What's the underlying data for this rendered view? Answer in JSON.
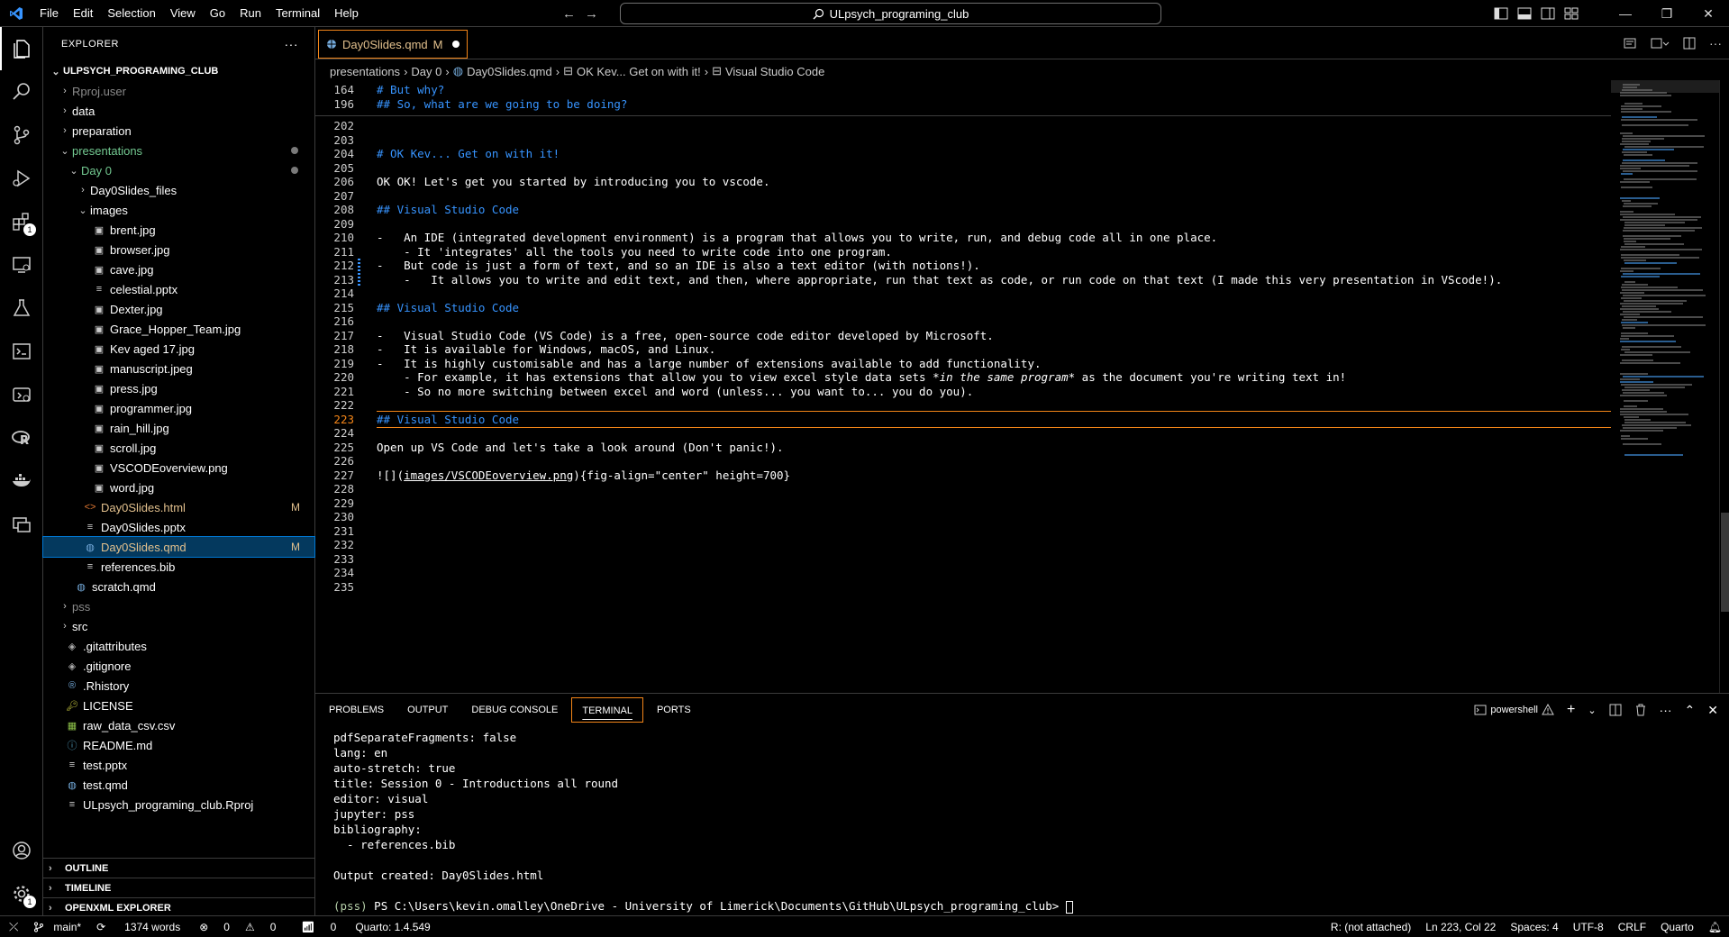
{
  "menu": [
    "File",
    "Edit",
    "Selection",
    "View",
    "Go",
    "Run",
    "Terminal",
    "Help"
  ],
  "search_label": "ULpsych_programing_club",
  "explorer": {
    "title": "EXPLORER",
    "more": "···",
    "root": "ULPSYCH_PROGRAMING_CLUB",
    "items": [
      {
        "label": "Rproj.user",
        "depth": 1,
        "type": "folder",
        "open": false,
        "muted": true
      },
      {
        "label": "data",
        "depth": 1,
        "type": "folder",
        "open": false
      },
      {
        "label": "preparation",
        "depth": 1,
        "type": "folder",
        "open": false
      },
      {
        "label": "presentations",
        "depth": 1,
        "type": "folder",
        "open": true,
        "color": "#73c991",
        "dot": true
      },
      {
        "label": "Day 0",
        "depth": 2,
        "type": "folder",
        "open": true,
        "color": "#73c991",
        "dot": true
      },
      {
        "label": "Day0Slides_files",
        "depth": 3,
        "type": "folder",
        "open": false
      },
      {
        "label": "images",
        "depth": 3,
        "type": "folder",
        "open": true
      },
      {
        "label": "brent.jpg",
        "depth": 4,
        "type": "img"
      },
      {
        "label": "browser.jpg",
        "depth": 4,
        "type": "img"
      },
      {
        "label": "cave.jpg",
        "depth": 4,
        "type": "img"
      },
      {
        "label": "celestial.pptx",
        "depth": 4,
        "type": "doc"
      },
      {
        "label": "Dexter.jpg",
        "depth": 4,
        "type": "img"
      },
      {
        "label": "Grace_Hopper_Team.jpg",
        "depth": 4,
        "type": "img"
      },
      {
        "label": "Kev aged 17.jpg",
        "depth": 4,
        "type": "img"
      },
      {
        "label": "manuscript.jpeg",
        "depth": 4,
        "type": "img"
      },
      {
        "label": "press.jpg",
        "depth": 4,
        "type": "img"
      },
      {
        "label": "programmer.jpg",
        "depth": 4,
        "type": "img"
      },
      {
        "label": "rain_hill.jpg",
        "depth": 4,
        "type": "img"
      },
      {
        "label": "scroll.jpg",
        "depth": 4,
        "type": "img"
      },
      {
        "label": "VSCODEoverview.png",
        "depth": 4,
        "type": "img"
      },
      {
        "label": "word.jpg",
        "depth": 4,
        "type": "img"
      },
      {
        "label": "Day0Slides.html",
        "depth": 3,
        "type": "html",
        "color": "#e2c08d",
        "mark": "M"
      },
      {
        "label": "Day0Slides.pptx",
        "depth": 3,
        "type": "doc"
      },
      {
        "label": "Day0Slides.qmd",
        "depth": 3,
        "type": "qmd",
        "color": "#e2c08d",
        "mark": "M",
        "selected": true
      },
      {
        "label": "references.bib",
        "depth": 3,
        "type": "doc"
      },
      {
        "label": "scratch.qmd",
        "depth": 2,
        "type": "qmd"
      },
      {
        "label": "pss",
        "depth": 1,
        "type": "folder",
        "open": false,
        "muted": true
      },
      {
        "label": "src",
        "depth": 1,
        "type": "folder",
        "open": false
      },
      {
        "label": ".gitattributes",
        "depth": 1,
        "type": "git"
      },
      {
        "label": ".gitignore",
        "depth": 1,
        "type": "git"
      },
      {
        "label": ".Rhistory",
        "depth": 1,
        "type": "r"
      },
      {
        "label": "LICENSE",
        "depth": 1,
        "type": "lic"
      },
      {
        "label": "raw_data_csv.csv",
        "depth": 1,
        "type": "csv"
      },
      {
        "label": "README.md",
        "depth": 1,
        "type": "info"
      },
      {
        "label": "test.pptx",
        "depth": 1,
        "type": "doc"
      },
      {
        "label": "test.qmd",
        "depth": 1,
        "type": "qmd"
      },
      {
        "label": "ULpsych_programing_club.Rproj",
        "depth": 1,
        "type": "doc"
      }
    ],
    "sections": [
      "OUTLINE",
      "TIMELINE",
      "OPENXML EXPLORER"
    ]
  },
  "tab": {
    "label": "Day0Slides.qmd",
    "mark": "M"
  },
  "breadcrumb": [
    "presentations",
    "Day 0",
    "Day0Slides.qmd",
    "OK Kev... Get on with it!",
    "Visual Studio Code"
  ],
  "editor": {
    "sticky": [
      {
        "n": "164",
        "t": "# But why?"
      },
      {
        "n": "196",
        "t": "## So, what are we going to be doing?"
      }
    ],
    "lines": [
      {
        "n": "202",
        "t": ""
      },
      {
        "n": "203",
        "t": ""
      },
      {
        "n": "204",
        "t": "# OK Kev... Get on with it!",
        "hd": true
      },
      {
        "n": "205",
        "t": ""
      },
      {
        "n": "206",
        "t": "OK OK! Let's get you started by introducing you to vscode."
      },
      {
        "n": "207",
        "t": ""
      },
      {
        "n": "208",
        "t": "## Visual Studio Code",
        "hd": true
      },
      {
        "n": "209",
        "t": ""
      },
      {
        "n": "210",
        "t": "-   An IDE (integrated development environment) is a program that allows you to write, run, and debug code all in one place."
      },
      {
        "n": "211",
        "t": "    - It 'integrates' all the tools you need to write code into one program."
      },
      {
        "n": "212",
        "t": "-   But code is just a form of text, and so an IDE is also a text editor (with notions!)."
      },
      {
        "n": "213",
        "t": "    -   It allows you to write and edit text, and then, where appropriate, run that text as code, or run code on that text (I made this very presentation in VScode!)."
      },
      {
        "n": "214",
        "t": ""
      },
      {
        "n": "215",
        "t": "## Visual Studio Code",
        "hd": true
      },
      {
        "n": "216",
        "t": ""
      },
      {
        "n": "217",
        "t": "-   Visual Studio Code (VS Code) is a free, open-source code editor developed by Microsoft."
      },
      {
        "n": "218",
        "t": "-   It is available for Windows, macOS, and Linux."
      },
      {
        "n": "219",
        "t": "-   It is highly customisable and has a large number of extensions available to add functionality."
      },
      {
        "n": "220",
        "t": "    - For example, it has extensions that allow you to view excel style data sets *in the same program* as the document you're writing text in!"
      },
      {
        "n": "221",
        "t": "    - So no more switching between excel and word (unless... you want to... you do you)."
      },
      {
        "n": "222",
        "t": ""
      },
      {
        "n": "223",
        "t": "## Visual Studio Code",
        "hd": true,
        "cur": true
      },
      {
        "n": "224",
        "t": ""
      },
      {
        "n": "225",
        "t": "Open up VS Code and let's take a look around (Don't panic!)."
      },
      {
        "n": "226",
        "t": ""
      },
      {
        "n": "227",
        "t": "![](images/VSCODEoverview.png){fig-align=\"center\" height=700}"
      },
      {
        "n": "228",
        "t": ""
      },
      {
        "n": "229",
        "t": ""
      },
      {
        "n": "230",
        "t": ""
      },
      {
        "n": "231",
        "t": ""
      },
      {
        "n": "232",
        "t": ""
      },
      {
        "n": "233",
        "t": ""
      },
      {
        "n": "234",
        "t": ""
      },
      {
        "n": "235",
        "t": ""
      }
    ]
  },
  "panel": {
    "tabs": [
      "PROBLEMS",
      "OUTPUT",
      "DEBUG CONSOLE",
      "TERMINAL",
      "PORTS"
    ],
    "active": "TERMINAL",
    "shell": "powershell",
    "terminal": [
      "pdfSeparateFragments: false",
      "lang: en",
      "auto-stretch: true",
      "title: Session 0 - Introductions all round",
      "editor: visual",
      "jupyter: pss",
      "bibliography:",
      "  - references.bib",
      "",
      "Output created: Day0Slides.html",
      ""
    ],
    "prompt_env": "(pss)",
    "prompt": " PS C:\\Users\\kevin.omalley\\OneDrive - University of Limerick\\Documents\\GitHub\\ULpsych_programing_club> "
  },
  "status": {
    "branch": "main*",
    "words": "1374 words",
    "errors": "0",
    "warnings": "0",
    "ports": "0",
    "quarto": "Quarto: 1.4.549",
    "r": "R: (not attached)",
    "position": "Ln 223, Col 22",
    "spaces": "Spaces: 4",
    "encoding": "UTF-8",
    "eol": "CRLF",
    "lang": "Quarto"
  },
  "colors": {
    "accent": "#f38518",
    "heading": "#3794ff",
    "modified": "#e2c08d",
    "untracked": "#73c991"
  }
}
